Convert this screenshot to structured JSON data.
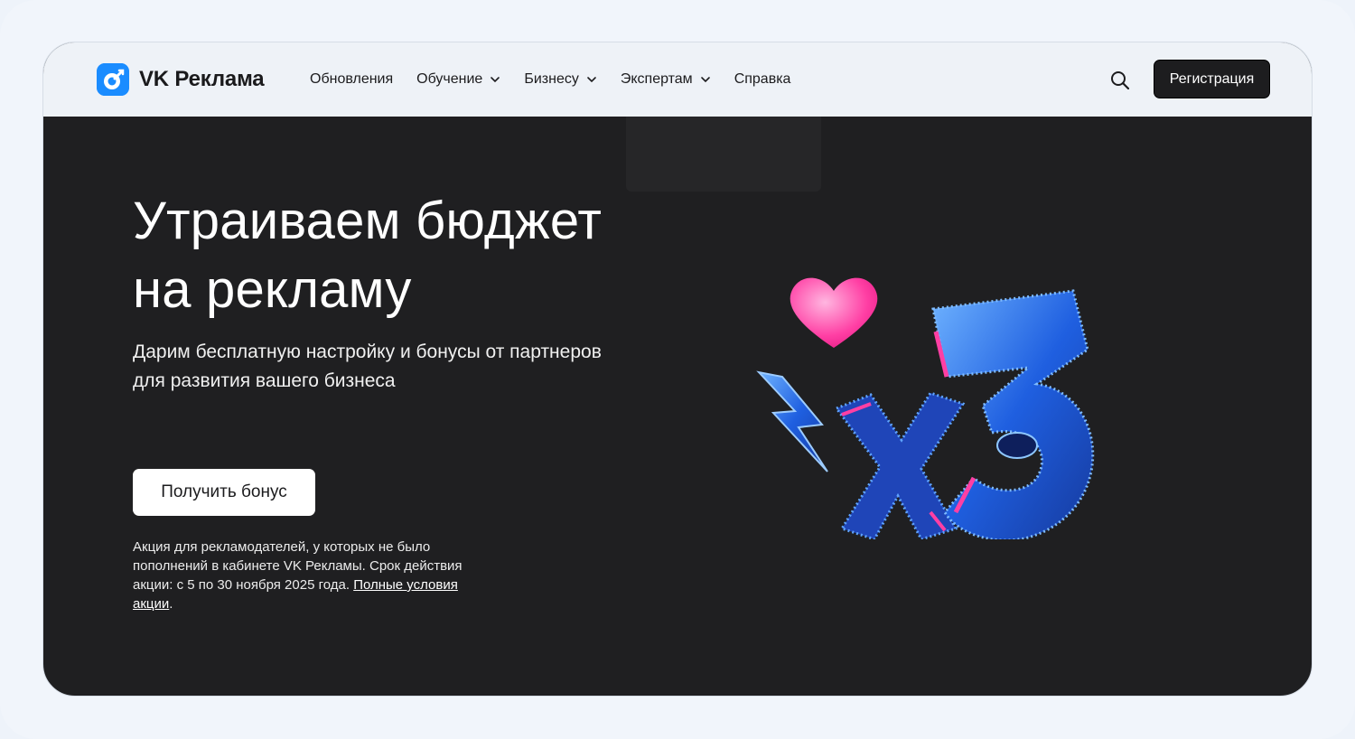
{
  "header": {
    "brand": "VK Реклама",
    "nav": [
      {
        "label": "Обновления",
        "has_dropdown": false
      },
      {
        "label": "Обучение",
        "has_dropdown": true
      },
      {
        "label": "Бизнесу",
        "has_dropdown": true
      },
      {
        "label": "Экспертам",
        "has_dropdown": true
      },
      {
        "label": "Справка",
        "has_dropdown": false
      }
    ],
    "search_icon": "search-icon",
    "register_label": "Регистрация"
  },
  "hero": {
    "title_line1": "Утраиваем бюджет",
    "title_line2": "на рекламу",
    "subtitle": "Дарим бесплатную настройку и бонусы от партнеров для развития вашего бизнеса",
    "cta_label": "Получить бонус",
    "note_text": "Акция для рекламодателей, у которых не было пополнений в кабинете VK Рекламы. Срок действия акции: с 5 по 30 ноября 2025 года.",
    "note_link": "Полные условия акции",
    "note_end": "."
  },
  "colors": {
    "page_bg": "#f1f5fb",
    "header_bg": "#eef2f7",
    "hero_bg": "#1f1f21",
    "brand_blue": "#1a8cff",
    "neon_blue": "#2e7bff",
    "neon_pink": "#ff3fa4"
  }
}
